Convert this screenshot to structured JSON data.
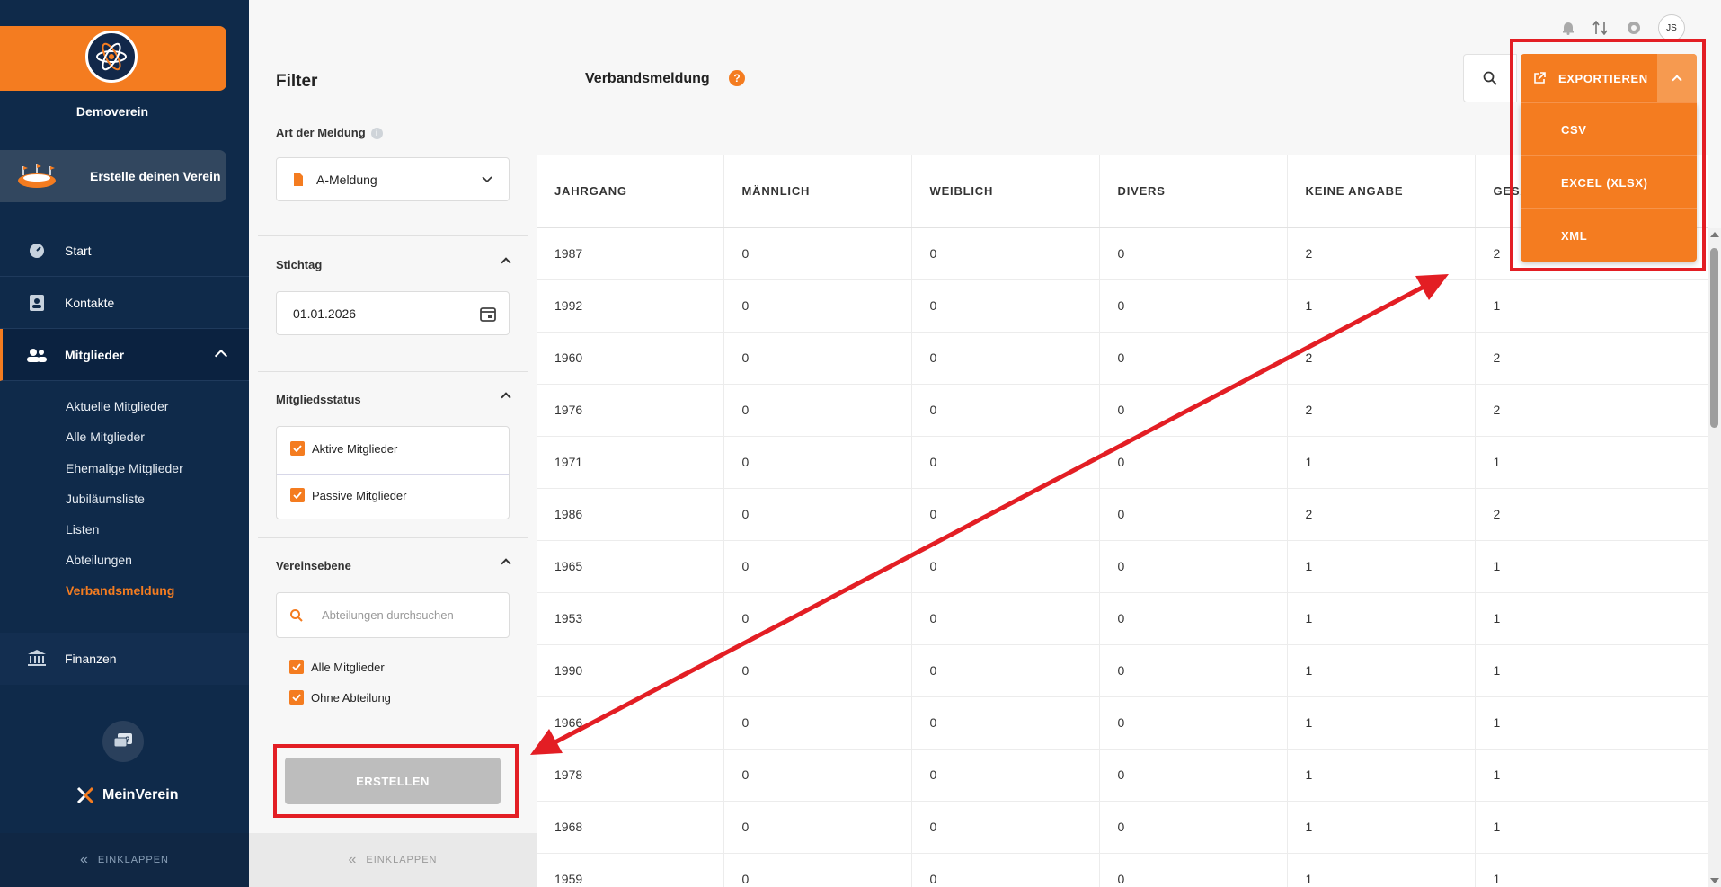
{
  "nav": {
    "club_name": "Demoverein",
    "create_club": "Erstelle deinen Verein",
    "items": [
      {
        "label": "Start"
      },
      {
        "label": "Kontakte"
      },
      {
        "label": "Mitglieder"
      }
    ],
    "sub_items": [
      "Aktuelle Mitglieder",
      "Alle Mitglieder",
      "Ehemalige Mitglieder",
      "Jubiläumsliste",
      "Listen",
      "Abteilungen",
      "Verbandsmeldung"
    ],
    "finanzen": "Finanzen",
    "brand": "MeinVerein",
    "collapse": "EINKLAPPEN"
  },
  "filter": {
    "title": "Filter",
    "art_label": "Art der Meldung",
    "art_value": "A-Meldung",
    "stichtag_label": "Stichtag",
    "stichtag_value": "01.01.2026",
    "status_label": "Mitgliedsstatus",
    "status_options": [
      "Aktive Mitglieder",
      "Passive Mitglieder"
    ],
    "ebene_label": "Vereinsebene",
    "search_placeholder": "Abteilungen durchsuchen",
    "ebene_options": [
      "Alle Mitglieder",
      "Ohne Abteilung"
    ],
    "create_button": "ERSTELLEN",
    "collapse": "EINKLAPPEN"
  },
  "header": {
    "title": "Verbandsmeldung",
    "help": "?",
    "avatar": "JS"
  },
  "export": {
    "label": "EXPORTIEREN",
    "options": [
      "CSV",
      "EXCEL (XLSX)",
      "XML"
    ]
  },
  "table": {
    "columns": [
      "JAHRGANG",
      "MÄNNLICH",
      "WEIBLICH",
      "DIVERS",
      "KEINE ANGABE",
      "GESAMT"
    ],
    "rows": [
      [
        "1987",
        "0",
        "0",
        "0",
        "2",
        "2"
      ],
      [
        "1992",
        "0",
        "0",
        "0",
        "1",
        "1"
      ],
      [
        "1960",
        "0",
        "0",
        "0",
        "2",
        "2"
      ],
      [
        "1976",
        "0",
        "0",
        "0",
        "2",
        "2"
      ],
      [
        "1971",
        "0",
        "0",
        "0",
        "1",
        "1"
      ],
      [
        "1986",
        "0",
        "0",
        "0",
        "2",
        "2"
      ],
      [
        "1965",
        "0",
        "0",
        "0",
        "1",
        "1"
      ],
      [
        "1953",
        "0",
        "0",
        "0",
        "1",
        "1"
      ],
      [
        "1990",
        "0",
        "0",
        "0",
        "1",
        "1"
      ],
      [
        "1966",
        "0",
        "0",
        "0",
        "1",
        "1"
      ],
      [
        "1978",
        "0",
        "0",
        "0",
        "1",
        "1"
      ],
      [
        "1968",
        "0",
        "0",
        "0",
        "1",
        "1"
      ],
      [
        "1959",
        "0",
        "0",
        "0",
        "1",
        "1"
      ]
    ]
  },
  "colors": {
    "accent": "#f47c20",
    "nav_bg": "#0f2a4a",
    "annotation": "#e31e24"
  }
}
